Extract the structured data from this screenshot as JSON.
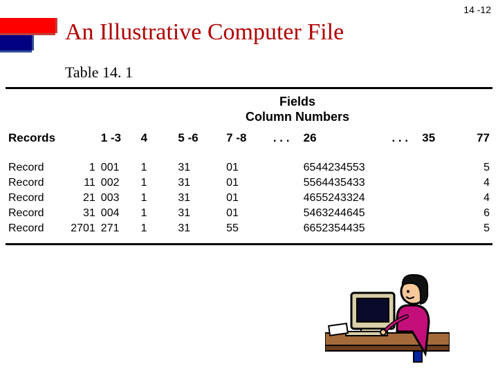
{
  "page_number": "14 -12",
  "title": "An Illustrative Computer File",
  "subtitle": "Table 14. 1",
  "fields_heading_line1": "Fields",
  "fields_heading_line2": "Column Numbers",
  "records_label": "Records",
  "columns": {
    "c1_3": "1 -3",
    "c4": "4",
    "c5_6": "5 -6",
    "c7_8": "7 -8",
    "dots1": ". . .",
    "c26": "26",
    "dots2": ". . .",
    "c35": "35",
    "c77": "77"
  },
  "rows": [
    {
      "label": "Record",
      "recno": "1",
      "c1_3": "001",
      "c4": "1",
      "c5_6": "31",
      "c7_8": "01",
      "c26": "6544234553",
      "c77": "5"
    },
    {
      "label": "Record",
      "recno": "11",
      "c1_3": "002",
      "c4": "1",
      "c5_6": "31",
      "c7_8": "01",
      "c26": "5564435433",
      "c77": "4"
    },
    {
      "label": "Record",
      "recno": "21",
      "c1_3": "003",
      "c4": "1",
      "c5_6": "31",
      "c7_8": "01",
      "c26": "4655243324",
      "c77": "4"
    },
    {
      "label": "Record",
      "recno": "31",
      "c1_3": "004",
      "c4": "1",
      "c5_6": "31",
      "c7_8": "01",
      "c26": "5463244645",
      "c77": "6"
    },
    {
      "label": "Record",
      "recno": "2701",
      "c1_3": "271",
      "c4": "1",
      "c5_6": "31",
      "c7_8": "55",
      "c26": "6652354435",
      "c77": "5"
    }
  ],
  "chart_data": {
    "type": "table",
    "title": "Table 14.1 — An Illustrative Computer File",
    "columns": [
      "Record #",
      "1-3",
      "4",
      "5-6",
      "7-8",
      "26",
      "77"
    ],
    "rows": [
      [
        "1",
        "001",
        "1",
        "31",
        "01",
        "6544234553",
        "5"
      ],
      [
        "11",
        "002",
        "1",
        "31",
        "01",
        "5564435433",
        "4"
      ],
      [
        "21",
        "003",
        "1",
        "31",
        "01",
        "4655243324",
        "4"
      ],
      [
        "31",
        "004",
        "1",
        "31",
        "01",
        "5463244645",
        "6"
      ],
      [
        "2701",
        "271",
        "1",
        "31",
        "55",
        "6652354435",
        "5"
      ]
    ]
  }
}
